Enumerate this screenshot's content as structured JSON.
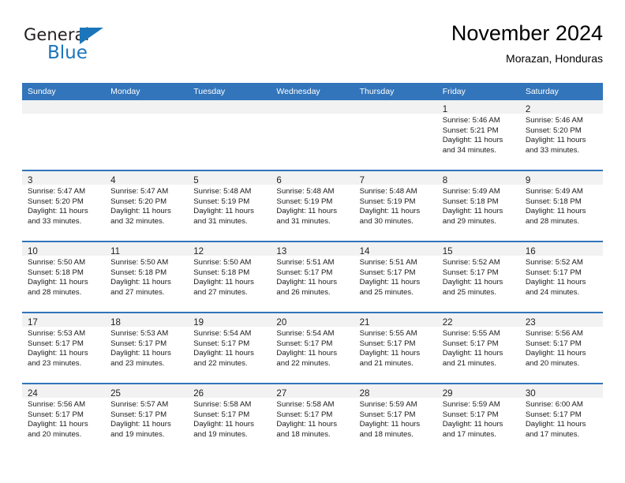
{
  "logo": {
    "word_top": "General",
    "word_bottom": "Blue",
    "accent_color": "#1b75bb"
  },
  "header": {
    "title": "November 2024",
    "subtitle": "Morazan, Honduras"
  },
  "calendar": {
    "header_color": "#3275bb",
    "weekday_headers": [
      "Sunday",
      "Monday",
      "Tuesday",
      "Wednesday",
      "Thursday",
      "Friday",
      "Saturday"
    ],
    "weeks": [
      [
        {
          "day": "",
          "lines": []
        },
        {
          "day": "",
          "lines": []
        },
        {
          "day": "",
          "lines": []
        },
        {
          "day": "",
          "lines": []
        },
        {
          "day": "",
          "lines": []
        },
        {
          "day": "1",
          "lines": [
            "Sunrise: 5:46 AM",
            "Sunset: 5:21 PM",
            "Daylight: 11 hours",
            "and 34 minutes."
          ]
        },
        {
          "day": "2",
          "lines": [
            "Sunrise: 5:46 AM",
            "Sunset: 5:20 PM",
            "Daylight: 11 hours",
            "and 33 minutes."
          ]
        }
      ],
      [
        {
          "day": "3",
          "lines": [
            "Sunrise: 5:47 AM",
            "Sunset: 5:20 PM",
            "Daylight: 11 hours",
            "and 33 minutes."
          ]
        },
        {
          "day": "4",
          "lines": [
            "Sunrise: 5:47 AM",
            "Sunset: 5:20 PM",
            "Daylight: 11 hours",
            "and 32 minutes."
          ]
        },
        {
          "day": "5",
          "lines": [
            "Sunrise: 5:48 AM",
            "Sunset: 5:19 PM",
            "Daylight: 11 hours",
            "and 31 minutes."
          ]
        },
        {
          "day": "6",
          "lines": [
            "Sunrise: 5:48 AM",
            "Sunset: 5:19 PM",
            "Daylight: 11 hours",
            "and 31 minutes."
          ]
        },
        {
          "day": "7",
          "lines": [
            "Sunrise: 5:48 AM",
            "Sunset: 5:19 PM",
            "Daylight: 11 hours",
            "and 30 minutes."
          ]
        },
        {
          "day": "8",
          "lines": [
            "Sunrise: 5:49 AM",
            "Sunset: 5:18 PM",
            "Daylight: 11 hours",
            "and 29 minutes."
          ]
        },
        {
          "day": "9",
          "lines": [
            "Sunrise: 5:49 AM",
            "Sunset: 5:18 PM",
            "Daylight: 11 hours",
            "and 28 minutes."
          ]
        }
      ],
      [
        {
          "day": "10",
          "lines": [
            "Sunrise: 5:50 AM",
            "Sunset: 5:18 PM",
            "Daylight: 11 hours",
            "and 28 minutes."
          ]
        },
        {
          "day": "11",
          "lines": [
            "Sunrise: 5:50 AM",
            "Sunset: 5:18 PM",
            "Daylight: 11 hours",
            "and 27 minutes."
          ]
        },
        {
          "day": "12",
          "lines": [
            "Sunrise: 5:50 AM",
            "Sunset: 5:18 PM",
            "Daylight: 11 hours",
            "and 27 minutes."
          ]
        },
        {
          "day": "13",
          "lines": [
            "Sunrise: 5:51 AM",
            "Sunset: 5:17 PM",
            "Daylight: 11 hours",
            "and 26 minutes."
          ]
        },
        {
          "day": "14",
          "lines": [
            "Sunrise: 5:51 AM",
            "Sunset: 5:17 PM",
            "Daylight: 11 hours",
            "and 25 minutes."
          ]
        },
        {
          "day": "15",
          "lines": [
            "Sunrise: 5:52 AM",
            "Sunset: 5:17 PM",
            "Daylight: 11 hours",
            "and 25 minutes."
          ]
        },
        {
          "day": "16",
          "lines": [
            "Sunrise: 5:52 AM",
            "Sunset: 5:17 PM",
            "Daylight: 11 hours",
            "and 24 minutes."
          ]
        }
      ],
      [
        {
          "day": "17",
          "lines": [
            "Sunrise: 5:53 AM",
            "Sunset: 5:17 PM",
            "Daylight: 11 hours",
            "and 23 minutes."
          ]
        },
        {
          "day": "18",
          "lines": [
            "Sunrise: 5:53 AM",
            "Sunset: 5:17 PM",
            "Daylight: 11 hours",
            "and 23 minutes."
          ]
        },
        {
          "day": "19",
          "lines": [
            "Sunrise: 5:54 AM",
            "Sunset: 5:17 PM",
            "Daylight: 11 hours",
            "and 22 minutes."
          ]
        },
        {
          "day": "20",
          "lines": [
            "Sunrise: 5:54 AM",
            "Sunset: 5:17 PM",
            "Daylight: 11 hours",
            "and 22 minutes."
          ]
        },
        {
          "day": "21",
          "lines": [
            "Sunrise: 5:55 AM",
            "Sunset: 5:17 PM",
            "Daylight: 11 hours",
            "and 21 minutes."
          ]
        },
        {
          "day": "22",
          "lines": [
            "Sunrise: 5:55 AM",
            "Sunset: 5:17 PM",
            "Daylight: 11 hours",
            "and 21 minutes."
          ]
        },
        {
          "day": "23",
          "lines": [
            "Sunrise: 5:56 AM",
            "Sunset: 5:17 PM",
            "Daylight: 11 hours",
            "and 20 minutes."
          ]
        }
      ],
      [
        {
          "day": "24",
          "lines": [
            "Sunrise: 5:56 AM",
            "Sunset: 5:17 PM",
            "Daylight: 11 hours",
            "and 20 minutes."
          ]
        },
        {
          "day": "25",
          "lines": [
            "Sunrise: 5:57 AM",
            "Sunset: 5:17 PM",
            "Daylight: 11 hours",
            "and 19 minutes."
          ]
        },
        {
          "day": "26",
          "lines": [
            "Sunrise: 5:58 AM",
            "Sunset: 5:17 PM",
            "Daylight: 11 hours",
            "and 19 minutes."
          ]
        },
        {
          "day": "27",
          "lines": [
            "Sunrise: 5:58 AM",
            "Sunset: 5:17 PM",
            "Daylight: 11 hours",
            "and 18 minutes."
          ]
        },
        {
          "day": "28",
          "lines": [
            "Sunrise: 5:59 AM",
            "Sunset: 5:17 PM",
            "Daylight: 11 hours",
            "and 18 minutes."
          ]
        },
        {
          "day": "29",
          "lines": [
            "Sunrise: 5:59 AM",
            "Sunset: 5:17 PM",
            "Daylight: 11 hours",
            "and 17 minutes."
          ]
        },
        {
          "day": "30",
          "lines": [
            "Sunrise: 6:00 AM",
            "Sunset: 5:17 PM",
            "Daylight: 11 hours",
            "and 17 minutes."
          ]
        }
      ]
    ]
  }
}
